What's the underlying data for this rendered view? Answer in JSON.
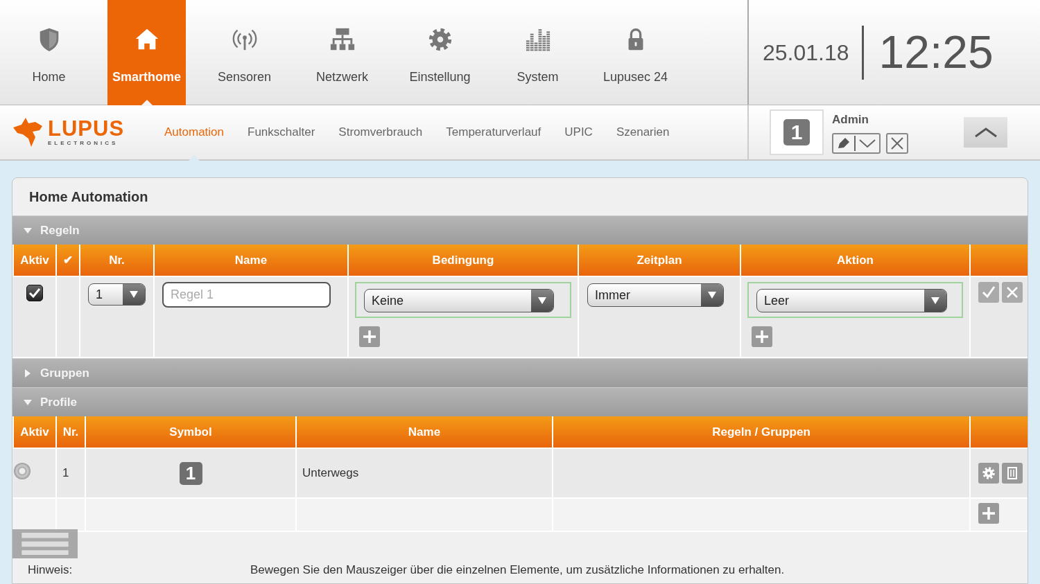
{
  "main_nav": [
    {
      "label": "Home",
      "selected": false
    },
    {
      "label": "Smarthome",
      "selected": true
    },
    {
      "label": "Sensoren",
      "selected": false
    },
    {
      "label": "Netzwerk",
      "selected": false
    },
    {
      "label": "Einstellung",
      "selected": false
    },
    {
      "label": "System",
      "selected": false
    },
    {
      "label": "Lupusec 24",
      "selected": false
    }
  ],
  "datetime": {
    "date": "25.01.18",
    "time": "12:25"
  },
  "logo": {
    "name": "LUPUS",
    "tagline": "ELECTRONICS"
  },
  "sub_nav": [
    {
      "label": "Automation",
      "selected": true
    },
    {
      "label": "Funkschalter",
      "selected": false
    },
    {
      "label": "Stromverbrauch",
      "selected": false
    },
    {
      "label": "Temperaturverlauf",
      "selected": false
    },
    {
      "label": "UPIC",
      "selected": false
    },
    {
      "label": "Szenarien",
      "selected": false
    }
  ],
  "user": {
    "name": "Admin",
    "symbol": "1"
  },
  "panel": {
    "title": "Home Automation"
  },
  "sections": [
    {
      "title": "Regeln",
      "kind": "rules",
      "expanded": true,
      "columns": [
        "Aktiv",
        "✔",
        "Nr.",
        "Name",
        "Bedingung",
        "Zeitplan",
        "Aktion"
      ],
      "rows": [
        {
          "active": true,
          "nr": "1",
          "name_placeholder": "Regel 1",
          "condition": "Keine",
          "schedule": "Immer",
          "action": "Leer"
        }
      ]
    },
    {
      "title": "Gruppen",
      "expanded": false
    },
    {
      "title": "Profile",
      "kind": "profiles",
      "expanded": true,
      "columns": [
        "Aktiv",
        "Nr.",
        "Symbol",
        "Name",
        "Regeln / Gruppen"
      ],
      "rows": [
        {
          "selected": false,
          "nr": "1",
          "symbol": "1",
          "name": "Unterwegs"
        }
      ]
    }
  ],
  "hint": {
    "label": "Hinweis:",
    "text": "Bewegen Sie den Mauszeiger über die einzelnen Elemente, um zusätzliche Informationen zu erhalten."
  }
}
